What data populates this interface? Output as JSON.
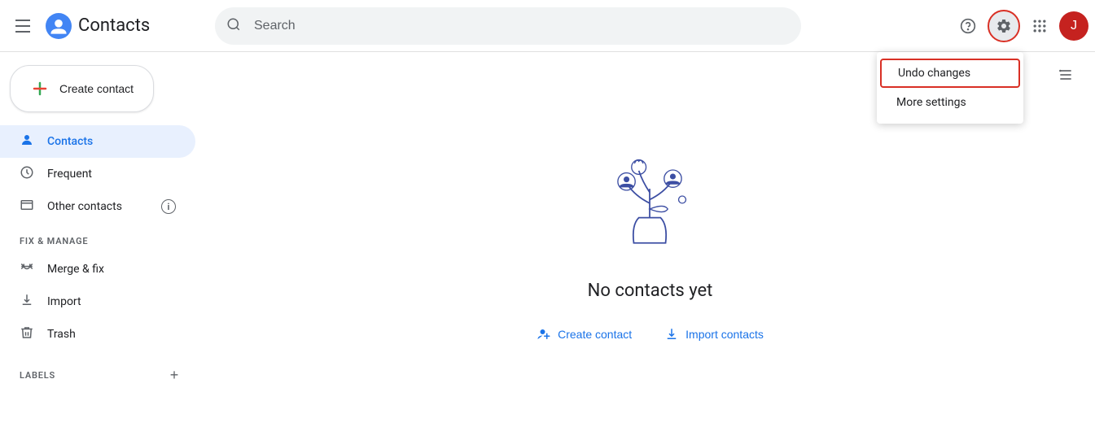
{
  "header": {
    "menu_label": "Main menu",
    "app_title": "Contacts",
    "search_placeholder": "Search",
    "help_icon": "?",
    "settings_icon": "⚙",
    "apps_icon": "⠿",
    "avatar_letter": "J"
  },
  "dropdown": {
    "undo_changes": "Undo changes",
    "more_settings": "More settings"
  },
  "sidebar": {
    "create_contact_label": "Create contact",
    "nav_items": [
      {
        "id": "contacts",
        "label": "Contacts",
        "icon": "person",
        "active": true
      },
      {
        "id": "frequent",
        "label": "Frequent",
        "icon": "history"
      }
    ],
    "other_contacts_label": "Other contacts",
    "fix_manage_title": "Fix & manage",
    "manage_items": [
      {
        "id": "merge",
        "label": "Merge & fix",
        "icon": "build"
      },
      {
        "id": "import",
        "label": "Import",
        "icon": "download"
      },
      {
        "id": "trash",
        "label": "Trash",
        "icon": "delete"
      }
    ],
    "labels_title": "Labels",
    "add_label_icon": "+"
  },
  "main": {
    "list_icon": "≡",
    "empty_title": "No contacts yet",
    "create_contact_link": "Create contact",
    "import_contacts_link": "Import contacts"
  }
}
